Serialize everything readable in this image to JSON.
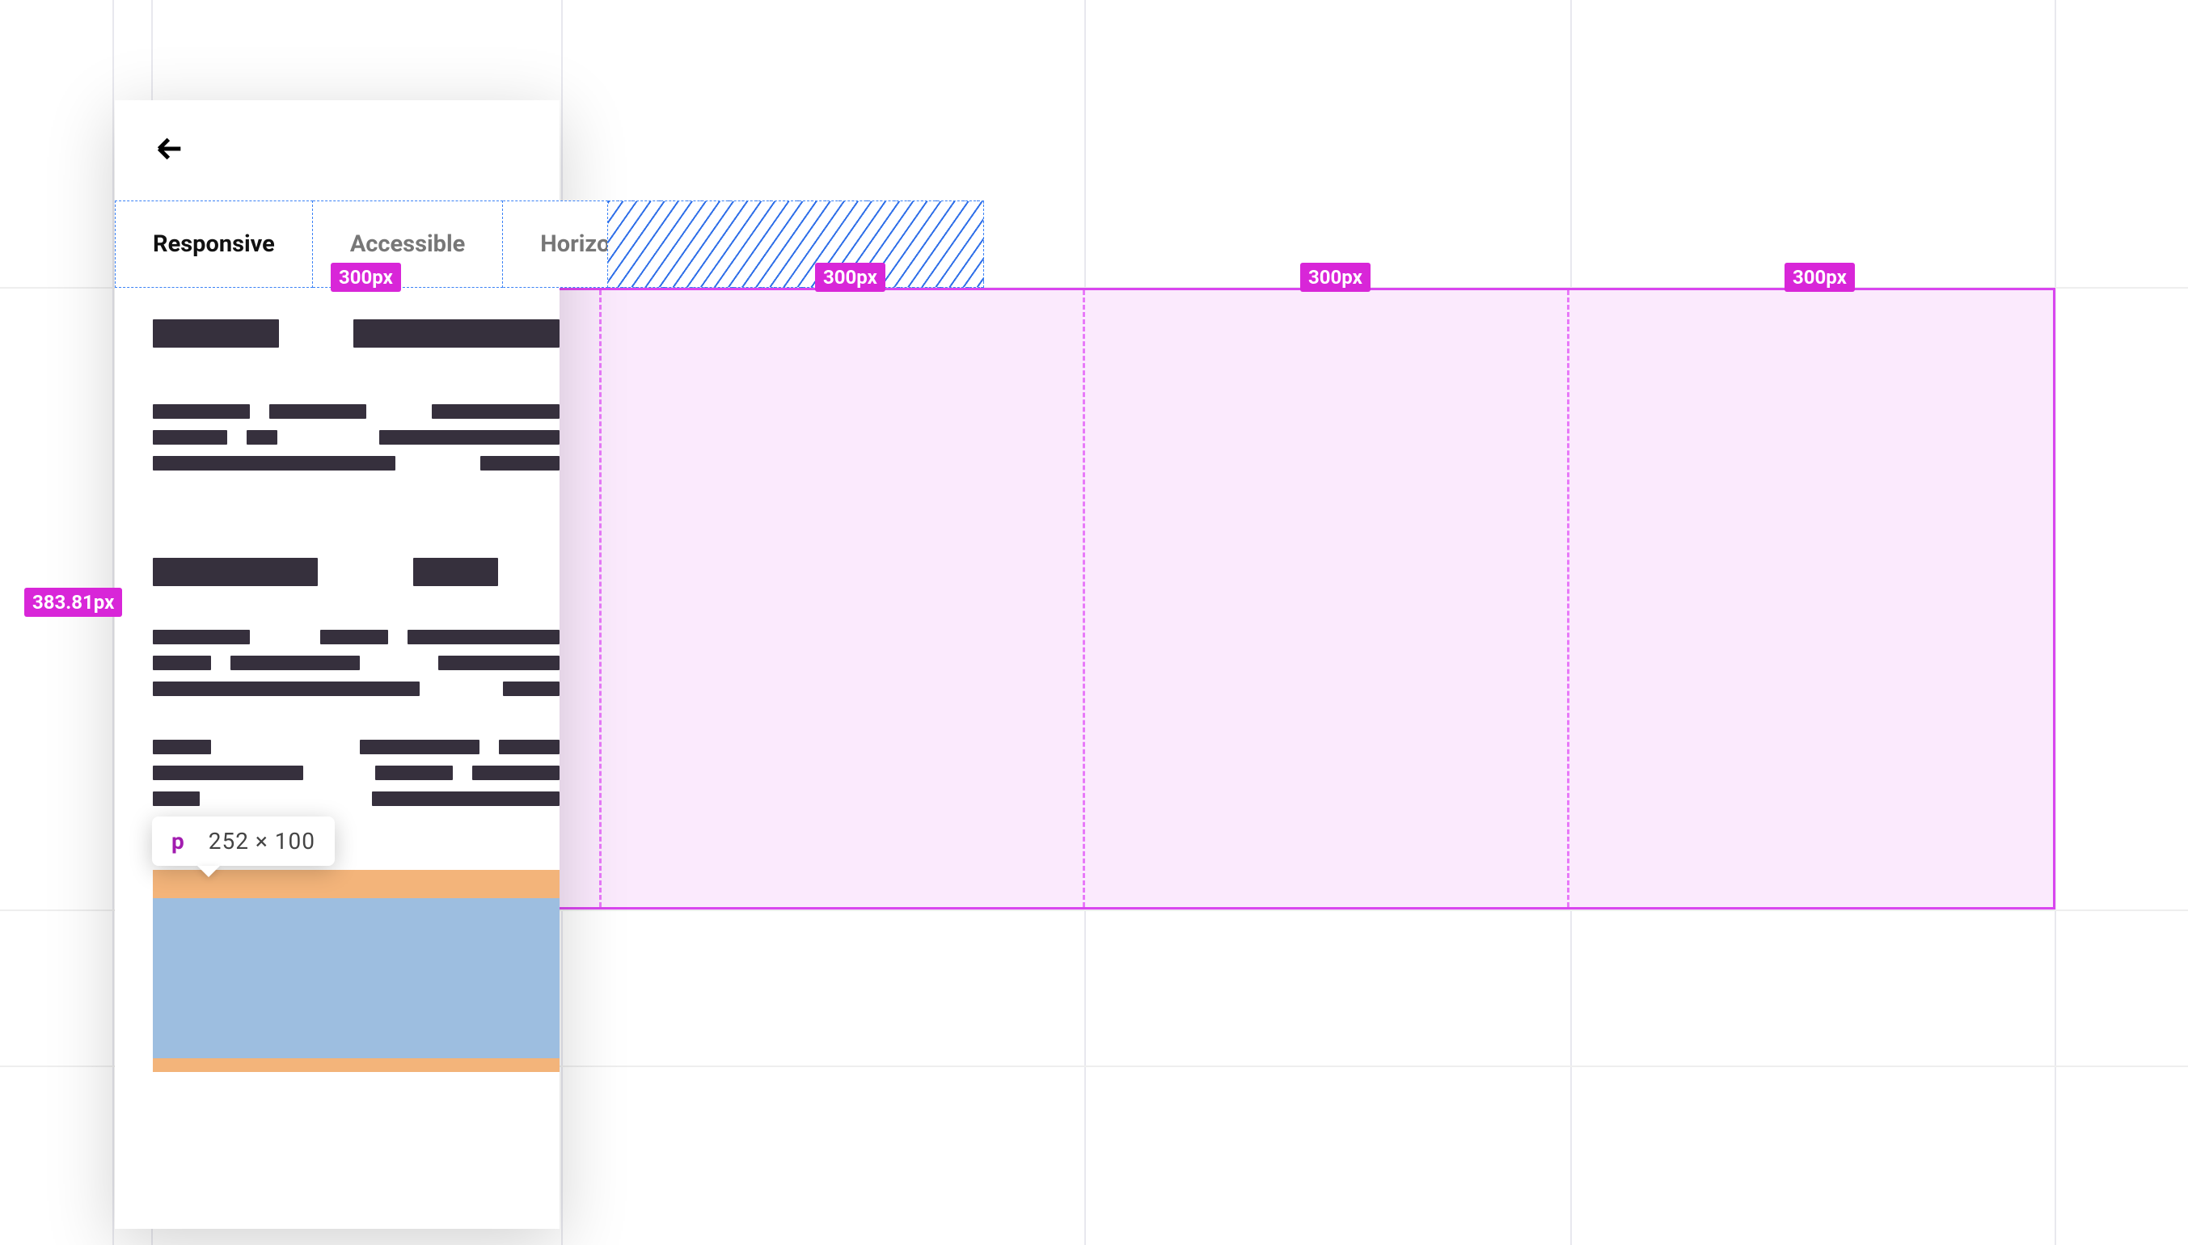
{
  "tabs": {
    "items": [
      "Responsive",
      "Accessible",
      "Horizontal"
    ],
    "active_index": 0
  },
  "grid_overlay": {
    "column_width_label": "300px",
    "height_label": "383.81px"
  },
  "inspect_tooltip": {
    "tag": "p",
    "dimensions": "252 × 100"
  }
}
